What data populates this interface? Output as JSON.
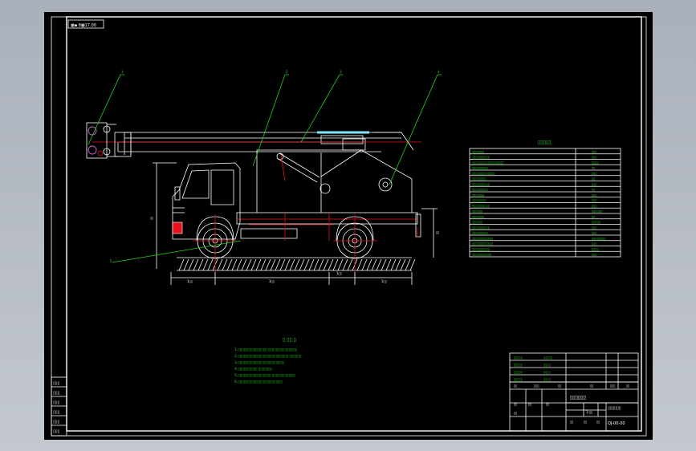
{
  "drawing": {
    "title_tag": "▩▪ 8▩17.00",
    "callouts": [
      "1",
      "2",
      "3",
      "4",
      "5"
    ],
    "dimensions": {
      "height_left": "▯▯",
      "height_right": "▯▯",
      "bottom": [
        "1▯▯",
        "3▯▯",
        "1▯▯",
        "1▯▯"
      ]
    }
  },
  "spec_table": {
    "title": "▯▯▯▯▯",
    "rows": [
      {
        "name": "▯▯▯▯▯▯▯",
        "value": "▯▯▯"
      },
      {
        "name": "▯▯▯▯▯▯▯▯▯▯",
        "value": "▯▯▯"
      },
      {
        "name": "▯▯▯▯▯▯▯▯▯▯▯▯▯▯▯▯▯▯",
        "value": "▯▯▯▯"
      },
      {
        "name": "▯▯▯▯▯▯▯▯▯",
        "value": "▯▯"
      },
      {
        "name": "▯▯▯▯▯▯▯▯▯▯▯▯▯",
        "value": "▯▯▯"
      },
      {
        "name": "▯▯▯▯▯▯▯▯",
        "value": "▯▯"
      },
      {
        "name": "▯▯▯▯▯▯▯▯▯▯",
        "value": "▯▯▯"
      },
      {
        "name": "▯▯▯▯▯▯▯▯▯",
        "value": "▯▯"
      },
      {
        "name": "▯▯▯▯▯▯▯",
        "value": "▯▯▯"
      },
      {
        "name": "▯▯▯▯▯▯▯▯",
        "value": "▯▯▯"
      },
      {
        "name": "▯▯▯▯▯▯▯▯▯▯",
        "value": "▯▯▯"
      },
      {
        "name": "▯▯▯▯▯▯",
        "value": "▯▯▯▯▯▯"
      },
      {
        "name": "▯▯▯▯▯▯▯",
        "value": "▯▯"
      },
      {
        "name": "▯▯▯▯▯▯",
        "value": "▯▯▯▯▯"
      },
      {
        "name": "▯▯▯▯▯▯▯▯▯▯",
        "value": "▯▯▯"
      },
      {
        "name": "▯▯▯▯▯▯▯▯▯",
        "value": "▯▯▯"
      },
      {
        "name": "▯▯▯▯▯▯▯▯▯▯▯▯",
        "value": "▯▯▯▯▯▯▯▯"
      },
      {
        "name": "▯▯▯▯▯▯▯▯▯▯▯▯",
        "value": "▯▯▯"
      },
      {
        "name": "▯▯▯▯▯▯▯▯▯▯",
        "value": "▯▯▯▯"
      },
      {
        "name": "▯▯▯▯▯▯▯▯▯▯▯",
        "value": "▯▯▯"
      }
    ]
  },
  "notes": {
    "title": "▯ ▯▯ ▯",
    "lines": [
      "1.▯▯▯▯▯▯▯▯▯▯▯▯▯▯▯ ▯▯▯▯▯▯▯▯▯▯▯▯▯▯▯",
      "2.▯▯▯▯▯▯▯▯▯▯▯▯▯▯▯▯▯▯▯▯▯▯▯▯▯▯ ▯▯▯▯▯▯",
      "3.▯▯▯▯▯▯▯▯▯▯▯▯▯▯▯▯▯▯▯▯▯▯▯▯",
      "4.▯▯▯▯▯▯▯▯▯▯ ▯▯▯▯▯▯▯",
      "5.▯▯▯▯▯▯▯▯▯▯▯▯▯▯▯▯▯ ▯▯▯▯▯▯▯▯▯▯▯▯",
      "6.▯▯▯▯▯▯▯▯▯▯▯▯▯▯▯▯▯▯▯▯▯▯▯"
    ]
  },
  "title_block": {
    "drawing_name": "▯▯▯▯▯▯",
    "drawing_number": "QJ-00-00",
    "scale_label": "1:▯▯",
    "designer_label": "▯▯",
    "small_labels": [
      "▯▯",
      "▯▯",
      "▯▯",
      "▯▯",
      "▯▯",
      "▯▯"
    ],
    "parts_rows": [
      {
        "no": "▯▯▯▯▯",
        "name": "▯▯▯▯▯"
      },
      {
        "no": "▯▯▯▯▯",
        "name": "▯▯▯▯"
      },
      {
        "no": "▯▯▯▯▯",
        "name": "▯▯▯▯"
      },
      {
        "no": "▯▯▯▯▯",
        "name": "▯▯▯▯"
      }
    ],
    "header_cols": [
      "▯▯",
      "▯▯▯",
      "▯▯",
      "▯▯",
      "▯▯▯",
      "▯▯"
    ]
  },
  "left_strip": [
    "▯▯▯",
    "▯▯▯",
    "▯▯▯",
    "▯▯▯",
    "▯▯▯",
    "▯▯▯"
  ],
  "colors": {
    "line": "#ffffff",
    "accent": "#24d41c",
    "center": "#e8101a",
    "cyan": "#7fe9ff"
  }
}
